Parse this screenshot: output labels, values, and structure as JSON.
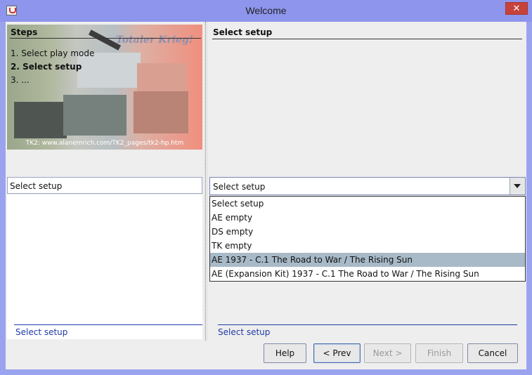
{
  "window": {
    "title": "Welcome",
    "close_glyph": "✕",
    "app_icon": "java-icon"
  },
  "steps": {
    "heading": "Steps",
    "items": [
      "1. Select play mode",
      "2. Select setup",
      "3. ..."
    ],
    "active_index": 1
  },
  "banner": {
    "title_text": "Totaler Krieg!",
    "url": "TK2: www.alanemrich.com/TK2_pages/tk2-hp.htm"
  },
  "left": {
    "field_value": "Select setup",
    "status": "Select setup"
  },
  "right": {
    "heading": "Select setup",
    "combo_value": "Select setup",
    "options": [
      "Select setup",
      "AE empty",
      "DS empty",
      "TK empty",
      "AE 1937 - C.1 The Road to War / The Rising Sun",
      "AE (Expansion Kit) 1937 - C.1 The Road to War / The Rising Sun"
    ],
    "selected_option_index": 4,
    "status": "Select setup"
  },
  "buttons": {
    "help": "Help",
    "prev": "< Prev",
    "next": "Next >",
    "finish": "Finish",
    "cancel": "Cancel"
  }
}
